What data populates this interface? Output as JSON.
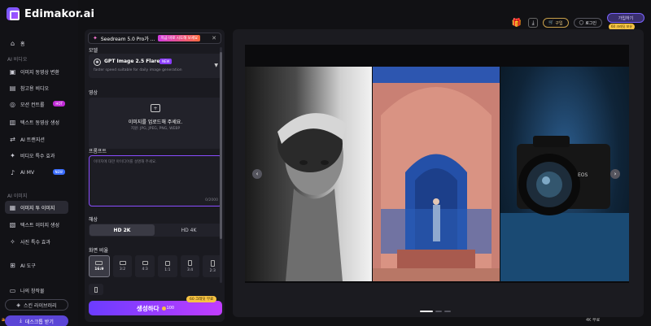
{
  "brand": {
    "name": "Edimakor.ai"
  },
  "sidebar": {
    "home": "홈",
    "section_video": "AI 비디오",
    "video_items": [
      {
        "label": "이미지 동영상 변환",
        "icon": "image-video-icon"
      },
      {
        "label": "참고용 비디오",
        "icon": "reference-video-icon"
      },
      {
        "label": "모션 컨트롤",
        "icon": "motion-control-icon",
        "badge": "HOT"
      },
      {
        "label": "텍스트 동영상 생성",
        "icon": "text-video-icon"
      },
      {
        "label": "AI 트랜지션",
        "icon": "transition-icon"
      },
      {
        "label": "비디오 특수 효과",
        "icon": "effects-icon"
      },
      {
        "label": "AI MV",
        "icon": "music-icon",
        "badge": "NEW"
      }
    ],
    "section_image": "AI 이미지",
    "image_items": [
      {
        "label": "이미지 투 이미지",
        "icon": "image-to-image-icon",
        "active": true
      },
      {
        "label": "텍스트 이미지 생성",
        "icon": "text-image-icon"
      },
      {
        "label": "사진 특수 효과",
        "icon": "photo-effects-icon"
      }
    ],
    "ai_tools": "AI 도구",
    "my_works": "나의 창작물",
    "library": "스킨 라이브러리",
    "desktop": "데스크톱 받기"
  },
  "topbar": {
    "purchase": "구입",
    "login": "로그인",
    "signup": "가입하기",
    "signup_badge": "60 크레딧 보유"
  },
  "panel": {
    "promo_title": "Seedream 5.0 Pro가 ...",
    "promo_tag": "지금 바로 시도해 보세요",
    "model_label": "모델",
    "model_name": "GPT Image 2.5 Flare",
    "model_badge": "NEW",
    "model_desc": "faster speed suitable for daily image generation",
    "upload_label": "영상",
    "upload_text": "이미지를 업로드해 주세요.",
    "upload_hint": "지원: JPG, JPEG, PNG, WEBP",
    "prompt_label": "프롬프트",
    "prompt_placeholder": "이미지에 대한 아이디어를 설명해 주세요.",
    "prompt_count": "0/2000",
    "resolution_label": "해상",
    "resolutions": [
      "HD 2K",
      "HD 4K"
    ],
    "ratio_label": "화면 비율",
    "ratios": [
      "16:9",
      "3:2",
      "4:3",
      "1:1",
      "3:4",
      "2:3"
    ],
    "generate": "생성하다",
    "generate_cost": "100",
    "generate_badge": "60 크레딧 무료"
  },
  "preview": {
    "corner_text": "4K 무료"
  },
  "colors": {
    "accent": "#8a4dff",
    "gold": "#f6c343",
    "active_bg": "#2a2a33"
  }
}
